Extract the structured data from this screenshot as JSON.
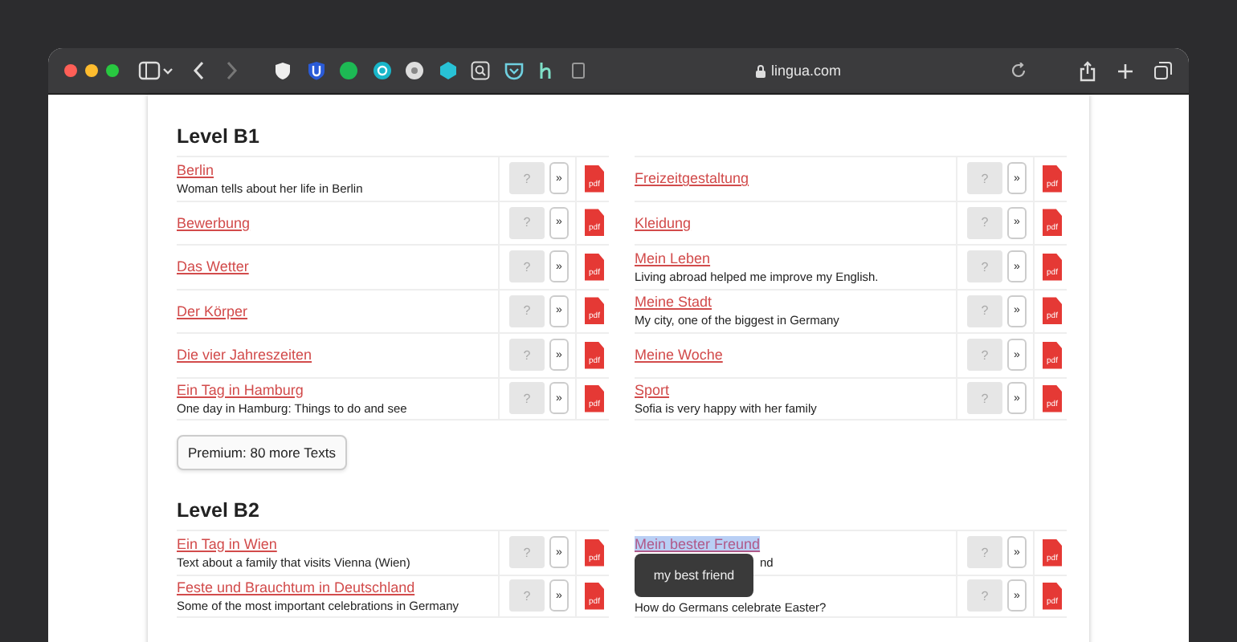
{
  "browser": {
    "url": "lingua.com"
  },
  "sections": [
    {
      "heading": "Level B1",
      "columns": [
        [
          {
            "title": "Berlin",
            "description": "Woman tells about her life in Berlin",
            "quiz": "?",
            "next": "»",
            "pdf": "pdf"
          },
          {
            "title": "Bewerbung",
            "quiz": "?",
            "next": "»",
            "pdf": "pdf"
          },
          {
            "title": "Das Wetter",
            "quiz": "?",
            "next": "»",
            "pdf": "pdf"
          },
          {
            "title": "Der Körper",
            "quiz": "?",
            "next": "»",
            "pdf": "pdf"
          },
          {
            "title": "Die vier Jahreszeiten",
            "quiz": "?",
            "next": "»",
            "pdf": "pdf"
          },
          {
            "title": "Ein Tag in Hamburg",
            "description": "One day in Hamburg: Things to do and see",
            "quiz": "?",
            "next": "»",
            "pdf": "pdf"
          }
        ],
        [
          {
            "title": "Freizeitgestaltung",
            "quiz": "?",
            "next": "»",
            "pdf": "pdf"
          },
          {
            "title": "Kleidung",
            "quiz": "?",
            "next": "»",
            "pdf": "pdf"
          },
          {
            "title": "Mein Leben",
            "description": "Living abroad helped me improve my English.",
            "quiz": "?",
            "next": "»",
            "pdf": "pdf"
          },
          {
            "title": "Meine Stadt",
            "description": "My city, one of the biggest in Germany",
            "quiz": "?",
            "next": "»",
            "pdf": "pdf"
          },
          {
            "title": "Meine Woche",
            "quiz": "?",
            "next": "»",
            "pdf": "pdf"
          },
          {
            "title": "Sport",
            "description": "Sofia is very happy with her family",
            "quiz": "?",
            "next": "»",
            "pdf": "pdf"
          }
        ]
      ],
      "premium_button": "Premium: 80 more Texts"
    },
    {
      "heading": "Level B2",
      "columns": [
        [
          {
            "title": "Ein Tag in Wien",
            "description": "Text about a family that visits Vienna (Wien)",
            "quiz": "?",
            "next": "»",
            "pdf": "pdf"
          },
          {
            "title": "Feste und Brauchtum in Deutschland",
            "description": "Some of the most important celebrations in Germany",
            "quiz": "?",
            "next": "»",
            "pdf": "pdf"
          }
        ],
        [
          {
            "title": "Mein bester Freund",
            "highlighted": true,
            "tooltip": "my best friend",
            "description": "nd",
            "quiz": "?",
            "next": "»",
            "pdf": "pdf"
          },
          {
            "description": "How do Germans celebrate Easter?",
            "quiz": "?",
            "next": "»",
            "pdf": "pdf"
          }
        ]
      ]
    }
  ]
}
